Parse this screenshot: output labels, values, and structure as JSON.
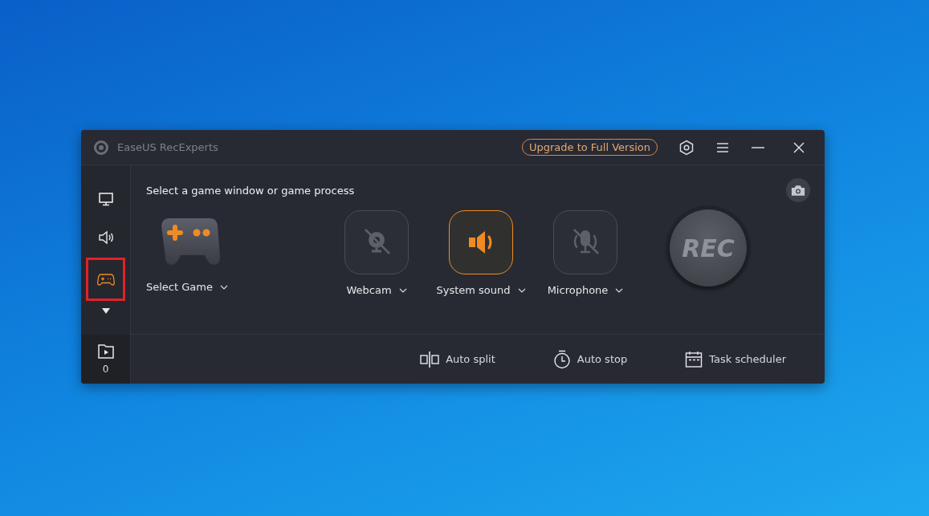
{
  "window": {
    "title": "EaseUS RecExperts",
    "upgrade_button": "Upgrade to Full Version"
  },
  "sidebar": {
    "items": [
      {
        "kind": "monitor",
        "selected": false,
        "highlighted": false
      },
      {
        "kind": "speaker",
        "selected": false,
        "highlighted": false
      },
      {
        "kind": "gamepad",
        "selected": true,
        "highlighted": true
      }
    ],
    "files_count": "0"
  },
  "main": {
    "heading": "Select a game window or game process",
    "game_select": "Select Game",
    "sources": [
      {
        "kind": "webcam",
        "label": "Webcam",
        "on": false
      },
      {
        "kind": "system_sound",
        "label": "System sound",
        "on": true
      },
      {
        "kind": "microphone",
        "label": "Microphone",
        "on": false
      }
    ],
    "rec_button": "REC"
  },
  "bottom_bar": [
    {
      "kind": "split",
      "label": "Auto split"
    },
    {
      "kind": "stop",
      "label": "Auto stop"
    },
    {
      "kind": "schedule",
      "label": "Task scheduler"
    }
  ]
}
